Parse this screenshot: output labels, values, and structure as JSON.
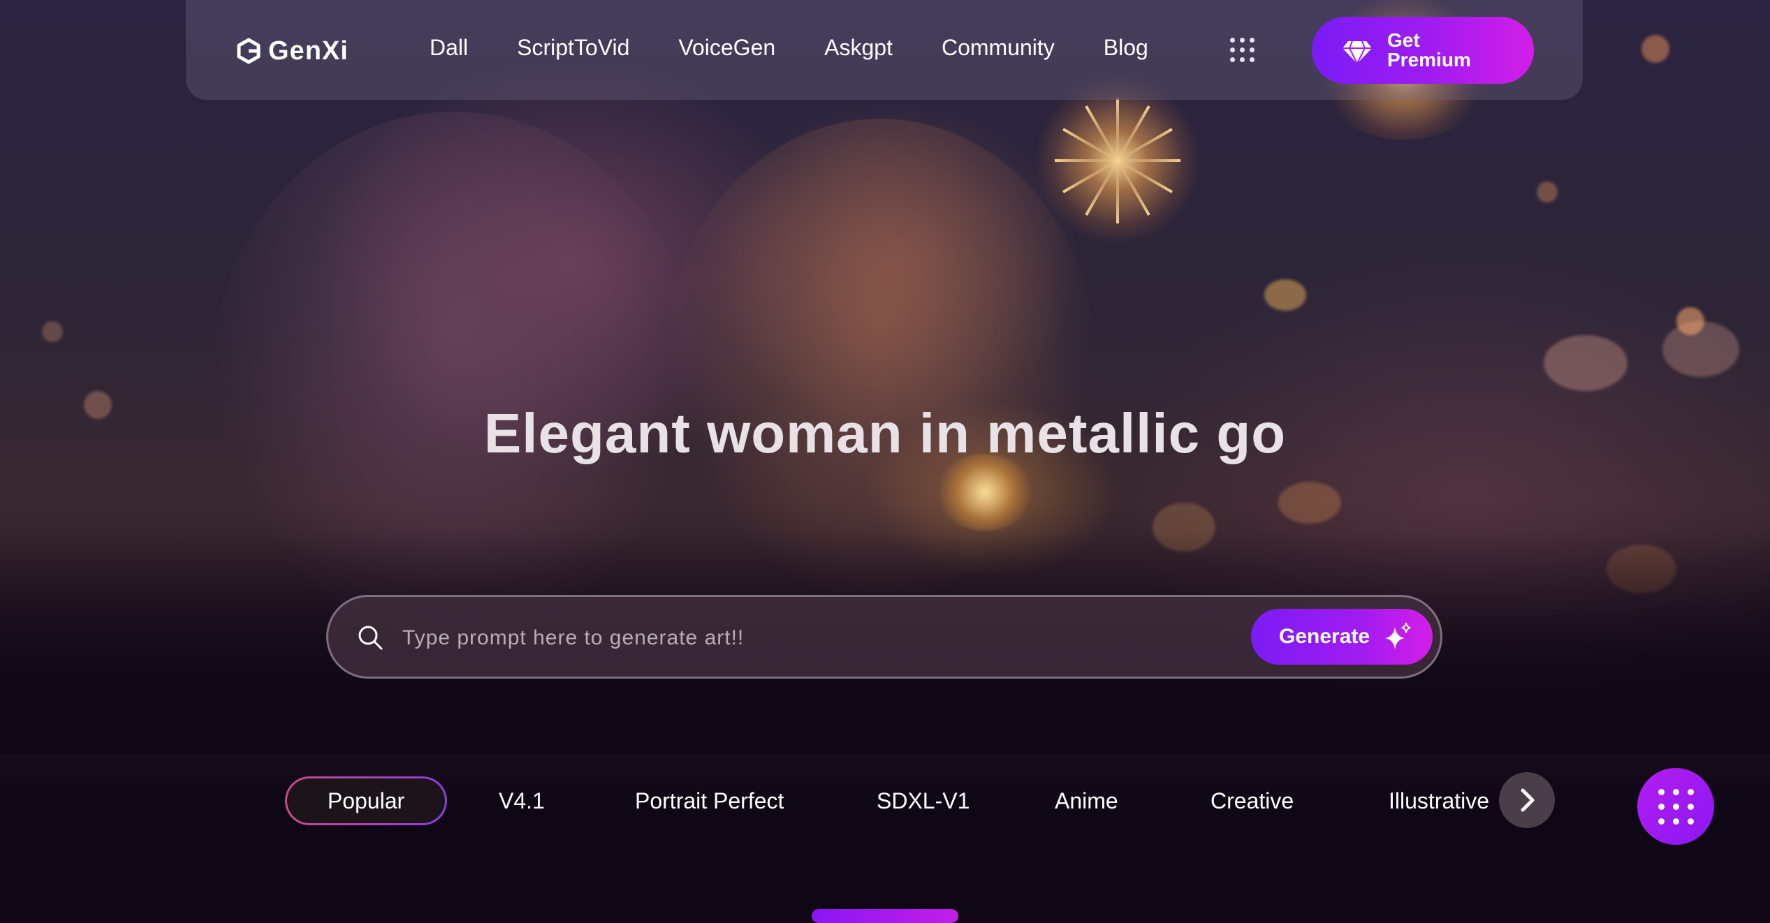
{
  "header": {
    "logo_text": "GenXi",
    "nav": [
      "Dall",
      "ScriptToVid",
      "VoiceGen",
      "Askgpt",
      "Community",
      "Blog"
    ],
    "premium_line1": "Get",
    "premium_line2": "Premium"
  },
  "hero": {
    "title": "Elegant woman in metallic go"
  },
  "search": {
    "placeholder": "Type prompt here to generate art!!",
    "value": "",
    "button_label": "Generate"
  },
  "tabs": {
    "items": [
      "Popular",
      "V4.1",
      "Portrait Perfect",
      "SDXL-V1",
      "Anime",
      "Creative",
      "Illustrative"
    ],
    "active": "Popular"
  },
  "icons": {
    "search": "search-icon",
    "apps": "apps-grid-icon",
    "premium": "diamond-icon",
    "generate": "sparkle-icon",
    "next": "chevron-right-icon",
    "fab": "apps-grid-icon"
  },
  "colors": {
    "accent_start": "#7a1cf5",
    "accent_end": "#d31ee8",
    "background": "#0f0716"
  }
}
